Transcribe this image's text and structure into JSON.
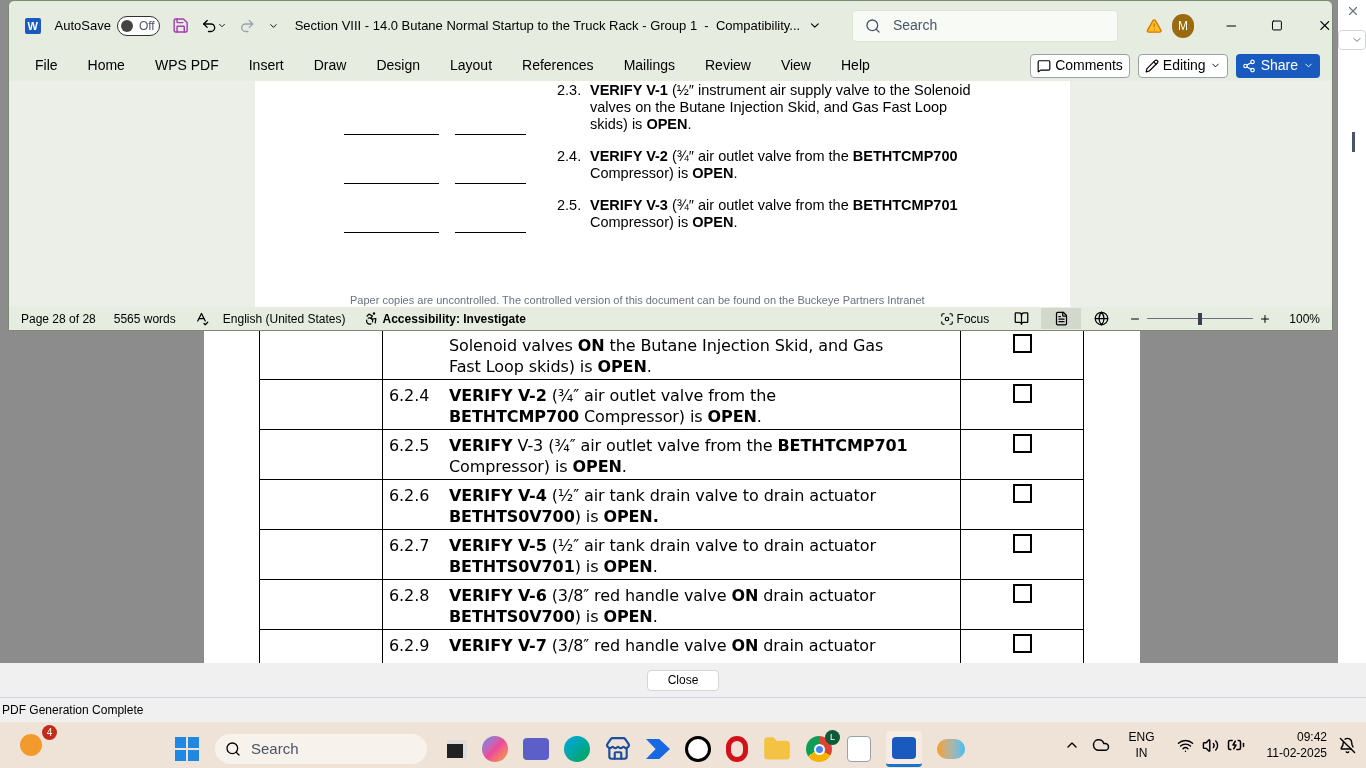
{
  "pdf_window": {
    "rows": [
      {
        "lines": [
          "Solenoid valves **ON** the Butane Injection Skid, and Gas",
          "Fast Loop skids) is **OPEN**."
        ],
        "checked": false
      },
      {
        "number": "6.2.4",
        "lines": [
          "**VERIFY V-2** (¾″ air outlet valve from the",
          "**BETHTCMP700** Compressor) is **OPEN**."
        ],
        "checked": false
      },
      {
        "number": "6.2.5",
        "lines": [
          "**VERIFY** V-3 (¾″ air outlet valve from the **BETHTCMP701**",
          "Compressor) is **OPEN**."
        ],
        "checked": false
      },
      {
        "number": "6.2.6",
        "lines": [
          "**VERIFY V-4** (½″ air tank drain valve to drain actuator",
          "**BETHTS0V700**) is **OPEN.**"
        ],
        "checked": false
      },
      {
        "number": "6.2.7",
        "lines": [
          "**VERIFY V-5** (½″ air tank drain valve to drain actuator",
          "**BETHTS0V701**) is **OPEN**."
        ],
        "checked": false
      },
      {
        "number": "6.2.8",
        "lines": [
          "**VERIFY V-6** (3/8″ red handle valve **ON** drain actuator",
          "**BETHTS0V700**) is **OPEN**."
        ],
        "checked": false
      },
      {
        "number": "6.2.9",
        "lines": [
          "**VERIFY V-7** (3/8″ red handle valve **ON** drain actuator"
        ],
        "checked": false
      }
    ],
    "close_button": "Close",
    "status": "PDF Generation Complete"
  },
  "word": {
    "app_letter": "W",
    "autosave_label": "AutoSave",
    "autosave": {
      "on": false,
      "label": "Off"
    },
    "title": "Section VIII - 14.0 Butane Normal Startup to the Truck Rack - Group 1  -  Compatibility...",
    "search_placeholder": "Search",
    "avatar": "M",
    "tabs": [
      "File",
      "Home",
      "WPS PDF",
      "Insert",
      "Draw",
      "Design",
      "Layout",
      "References",
      "Mailings",
      "Review",
      "View",
      "Help"
    ],
    "comments": "Comments",
    "editing": "Editing",
    "share": "Share",
    "items": [
      {
        "number": "2.3.",
        "lines": [
          "**VERIFY V-1** (½″ instrument air supply valve to the Solenoid",
          "valves on the Butane Injection Skid, and Gas Fast Loop",
          "skids) is **OPEN**."
        ]
      },
      {
        "number": "2.4.",
        "lines": [
          "**VERIFY V-2** (¾″ air outlet valve from the **BETHTCMP700**",
          "Compressor) is **OPEN**."
        ]
      },
      {
        "number": "2.5.",
        "lines": [
          "**VERIFY V-3** (¾″ air outlet valve from the **BETHTCMP701**",
          "Compressor) is **OPEN**."
        ]
      }
    ],
    "footer": "Paper copies are uncontrolled. The controlled version of this document can be found on the Buckeye Partners Intranet",
    "status": {
      "page": "Page 28 of 28",
      "words": "5565 words",
      "language": "English (United States)",
      "accessibility": "Accessibility: Investigate",
      "focus": "Focus",
      "zoom": "100%",
      "zoom_slider": {
        "level": 0.5
      },
      "views": [
        {
          "kind": "read",
          "selected": false
        },
        {
          "kind": "print",
          "selected": true
        },
        {
          "kind": "web",
          "selected": false
        }
      ]
    }
  },
  "taskbar": {
    "weather_badge": "4",
    "search_placeholder": "Search",
    "chrome_badge": "L",
    "language": "ENG",
    "region": "IN",
    "time": "09:42",
    "date": "11-02-2025"
  }
}
